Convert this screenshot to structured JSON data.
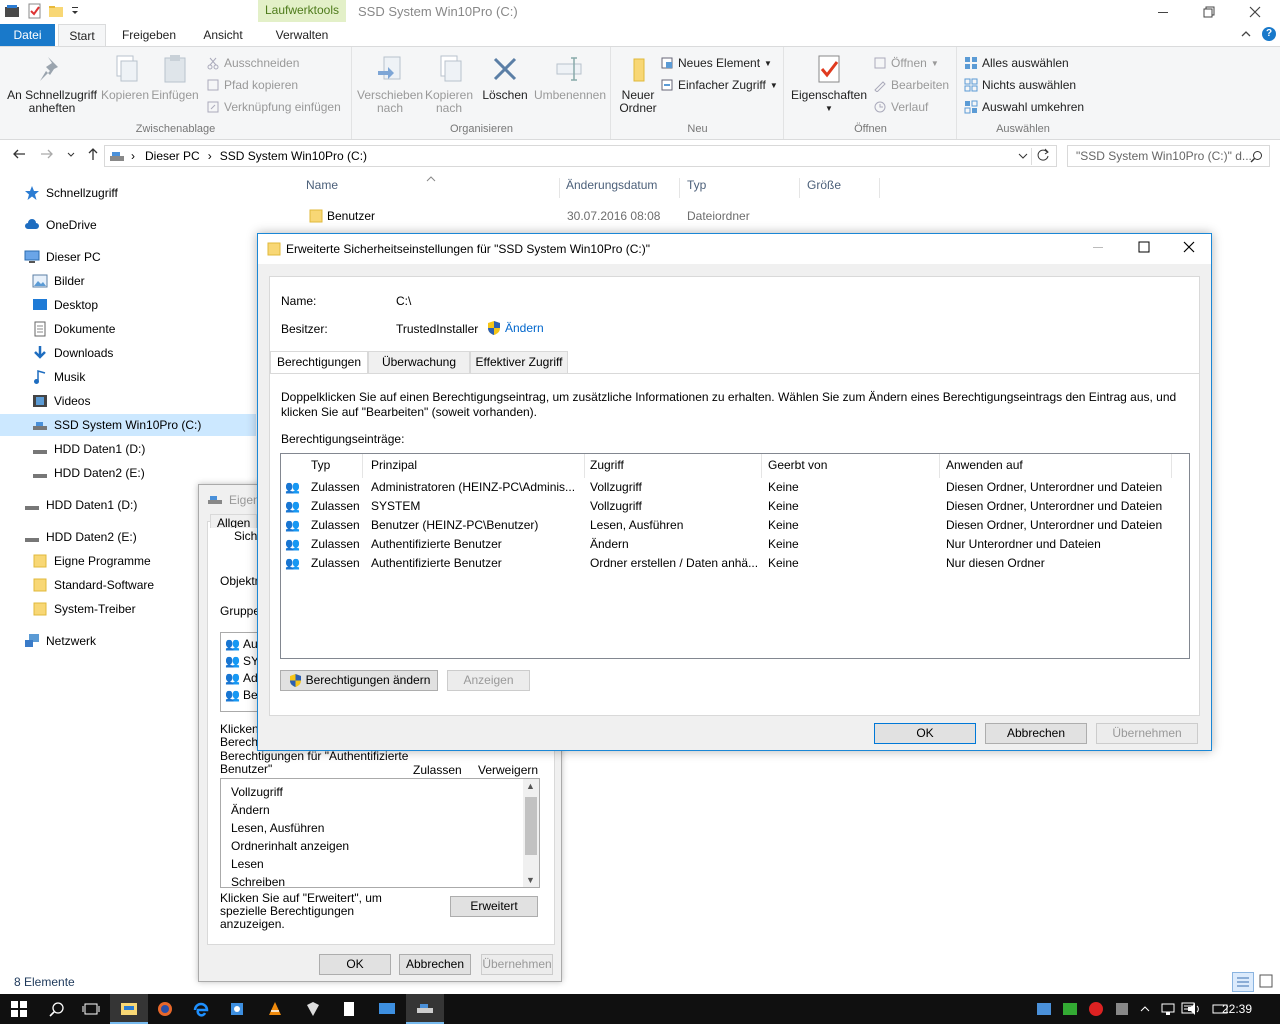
{
  "explorer": {
    "window_title": "SSD System Win10Pro (C:)",
    "context_tab_group": "Laufwerktools",
    "tabs": [
      {
        "label": "Datei"
      },
      {
        "label": "Start"
      },
      {
        "label": "Freigeben"
      },
      {
        "label": "Ansicht"
      },
      {
        "label": "Verwalten"
      }
    ],
    "ribbon": {
      "zwischenablage": {
        "label": "Zwischenablage",
        "pin_label_1": "An Schnellzugriff",
        "pin_label_2": "anheften",
        "copy": "Kopieren",
        "paste": "Einfügen",
        "cut": "Ausschneiden",
        "copy_path": "Pfad kopieren",
        "paste_shortcut": "Verknüpfung einfügen"
      },
      "organisieren": {
        "label": "Organisieren",
        "move_1": "Verschieben",
        "move_2": "nach",
        "copyto_1": "Kopieren",
        "copyto_2": "nach",
        "delete": "Löschen",
        "rename": "Umbenennen"
      },
      "neu": {
        "label": "Neu",
        "new_folder_1": "Neuer",
        "new_folder_2": "Ordner",
        "new_item": "Neues Element",
        "easy_access": "Einfacher Zugriff"
      },
      "oeffnen": {
        "label": "Öffnen",
        "properties": "Eigenschaften",
        "open": "Öffnen",
        "edit": "Bearbeiten",
        "history": "Verlauf"
      },
      "auswaehlen": {
        "label": "Auswählen",
        "select_all": "Alles auswählen",
        "select_none": "Nichts auswählen",
        "invert": "Auswahl umkehren"
      }
    },
    "address": {
      "crumb_1": "Dieser PC",
      "crumb_2": "SSD System Win10Pro (C:)",
      "search_placeholder": "\"SSD System Win10Pro (C:)\" d..."
    },
    "nav": [
      {
        "label": "Schnellzugriff",
        "icon": "star-icon"
      },
      {
        "label": "OneDrive",
        "icon": "cloud-icon"
      },
      {
        "label": "Dieser PC",
        "icon": "computer-icon"
      },
      {
        "label": "Bilder",
        "icon": "pictures-icon"
      },
      {
        "label": "Desktop",
        "icon": "desktop-icon"
      },
      {
        "label": "Dokumente",
        "icon": "documents-icon"
      },
      {
        "label": "Downloads",
        "icon": "download-icon"
      },
      {
        "label": "Musik",
        "icon": "music-icon"
      },
      {
        "label": "Videos",
        "icon": "videos-icon"
      },
      {
        "label": "SSD System Win10Pro (C:)",
        "icon": "drive-icon"
      },
      {
        "label": "HDD Daten1 (D:)",
        "icon": "drive-icon"
      },
      {
        "label": "HDD Daten2 (E:)",
        "icon": "drive-icon"
      },
      {
        "label": "HDD Daten1 (D:)",
        "icon": "drive-icon"
      },
      {
        "label": "HDD Daten2 (E:)",
        "icon": "drive-icon"
      },
      {
        "label": "Eigne Programme",
        "icon": "folder-icon"
      },
      {
        "label": "Standard-Software",
        "icon": "folder-icon"
      },
      {
        "label": "System-Treiber",
        "icon": "folder-icon"
      },
      {
        "label": "Netzwerk",
        "icon": "network-icon"
      }
    ],
    "columns": {
      "name": "Name",
      "date": "Änderungsdatum",
      "type": "Typ",
      "size": "Größe"
    },
    "files": [
      {
        "name": "Benutzer",
        "date": "30.07.2016 08:08",
        "type": "Dateiordner"
      }
    ],
    "status": "8 Elemente"
  },
  "prop_dialog": {
    "title": "Eigen",
    "tab_1": "Allgen",
    "tab_2": "Siche",
    "objekt_label": "Objektn",
    "gruppen_label": "Gruppen",
    "list_items": [
      "Au",
      "SY",
      "Ad",
      "Be"
    ],
    "click_text_1": "Klicken",
    "click_text_2": "Berecht",
    "perms_for": "Berechtigungen für \"Authentifizierte Benutzer\"",
    "col_allow": "Zulassen",
    "col_deny": "Verweigern",
    "permissions": [
      "Vollzugriff",
      "Ändern",
      "Lesen, Ausführen",
      "Ordnerinhalt anzeigen",
      "Lesen",
      "Schreiben"
    ],
    "advanced_hint": "Klicken Sie auf \"Erweitert\", um spezielle Berechtigungen anzuzeigen.",
    "advanced_button": "Erweitert",
    "ok": "OK",
    "cancel": "Abbrechen",
    "apply": "Übernehmen"
  },
  "sec_dialog": {
    "title": "Erweiterte Sicherheitseinstellungen für \"SSD System Win10Pro (C:)\"",
    "name_label": "Name:",
    "name_value": "C:\\",
    "owner_label": "Besitzer:",
    "owner_value": "TrustedInstaller",
    "change_link": "Ändern",
    "tabs": [
      "Berechtigungen",
      "Überwachung",
      "Effektiver Zugriff"
    ],
    "info_text_1": "Doppelklicken Sie auf einen Berechtigungseintrag, um zusätzliche Informationen zu erhalten. Wählen Sie zum Ändern eines Berechtigungseintrags den Eintrag aus, und",
    "info_text_2": "klicken Sie auf \"Bearbeiten\" (soweit vorhanden).",
    "entries_label": "Berechtigungseinträge:",
    "headers": {
      "typ": "Typ",
      "prinzipal": "Prinzipal",
      "zugriff": "Zugriff",
      "geerbt": "Geerbt von",
      "anwenden": "Anwenden auf"
    },
    "rows": [
      {
        "typ": "Zulassen",
        "prinzipal": "Administratoren (HEINZ-PC\\Adminis...",
        "zugriff": "Vollzugriff",
        "geerbt": "Keine",
        "anwenden": "Diesen Ordner, Unterordner und Dateien"
      },
      {
        "typ": "Zulassen",
        "prinzipal": "SYSTEM",
        "zugriff": "Vollzugriff",
        "geerbt": "Keine",
        "anwenden": "Diesen Ordner, Unterordner und Dateien"
      },
      {
        "typ": "Zulassen",
        "prinzipal": "Benutzer (HEINZ-PC\\Benutzer)",
        "zugriff": "Lesen, Ausführen",
        "geerbt": "Keine",
        "anwenden": "Diesen Ordner, Unterordner und Dateien"
      },
      {
        "typ": "Zulassen",
        "prinzipal": "Authentifizierte Benutzer",
        "zugriff": "Ändern",
        "geerbt": "Keine",
        "anwenden": "Nur Unterordner und Dateien"
      },
      {
        "typ": "Zulassen",
        "prinzipal": "Authentifizierte Benutzer",
        "zugriff": "Ordner erstellen / Daten anhä...",
        "geerbt": "Keine",
        "anwenden": "Nur diesen Ordner"
      }
    ],
    "change_perms_button": "Berechtigungen ändern",
    "show_button": "Anzeigen",
    "ok": "OK",
    "cancel": "Abbrechen",
    "apply": "Übernehmen"
  },
  "taskbar": {
    "clock": "22:39"
  }
}
